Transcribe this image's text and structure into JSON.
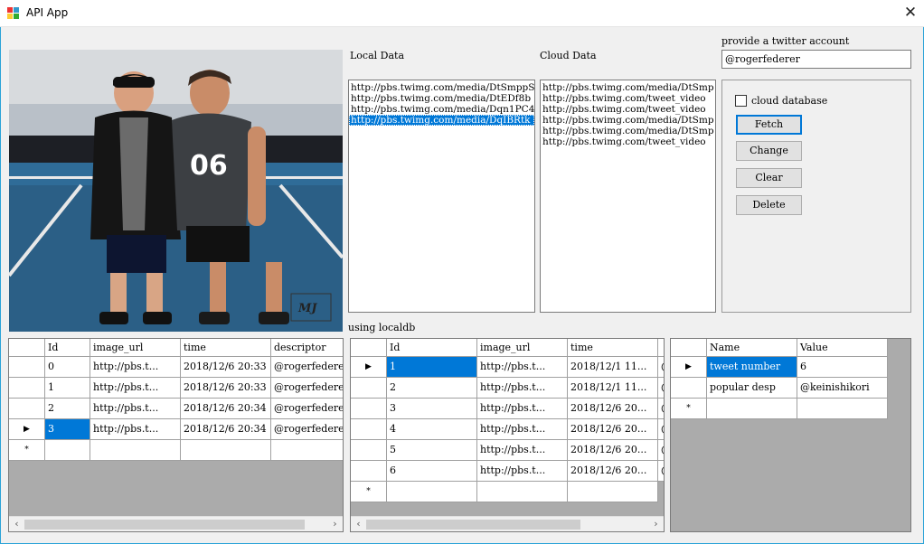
{
  "window": {
    "title": "API App",
    "close_glyph": "✕"
  },
  "labels": {
    "local_data": "Local Data",
    "cloud_data": "Cloud Data",
    "provide_account": "provide a twitter account",
    "using_localdb": "using localdb"
  },
  "account_input": {
    "value": "@rogerfederer"
  },
  "local_list": [
    {
      "text": "http://pbs.twimg.com/media/DtSmppS",
      "selected": false
    },
    {
      "text": "http://pbs.twimg.com/media/DtEDf8b",
      "selected": false
    },
    {
      "text": "http://pbs.twimg.com/media/Dqn1PC4",
      "selected": false
    },
    {
      "text": "http://pbs.twimg.com/media/DqIBRtk",
      "selected": true
    }
  ],
  "cloud_list": [
    "http://pbs.twimg.com/media/DtSmp",
    "http://pbs.twimg.com/tweet_video",
    "http://pbs.twimg.com/tweet_video",
    "http://pbs.twimg.com/media/DtSmp",
    "http://pbs.twimg.com/media/DtSmp",
    "http://pbs.twimg.com/tweet_video"
  ],
  "controls": {
    "cloud_database_label": "cloud database",
    "fetch": "Fetch",
    "change": "Change",
    "clear": "Clear",
    "delete": "Delete"
  },
  "grid_local": {
    "headers": [
      "Id",
      "image_url",
      "time",
      "descriptor"
    ],
    "rows": [
      [
        "0",
        "http://pbs.t...",
        "2018/12/6 20:33",
        "@rogerfederer"
      ],
      [
        "1",
        "http://pbs.t...",
        "2018/12/6 20:33",
        "@rogerfederer"
      ],
      [
        "2",
        "http://pbs.t...",
        "2018/12/6 20:34",
        "@rogerfederer"
      ],
      [
        "3",
        "http://pbs.t...",
        "2018/12/6 20:34",
        "@rogerfederer"
      ]
    ],
    "current_row": 3,
    "new_row_glyph": "*"
  },
  "grid_db": {
    "headers": [
      "Id",
      "image_url",
      "time"
    ],
    "rows": [
      [
        "1",
        "http://pbs.t...",
        "2018/12/1 11...",
        "@"
      ],
      [
        "2",
        "http://pbs.t...",
        "2018/12/1 11...",
        "@"
      ],
      [
        "3",
        "http://pbs.t...",
        "2018/12/6 20...",
        "@"
      ],
      [
        "4",
        "http://pbs.t...",
        "2018/12/6 20...",
        "@"
      ],
      [
        "5",
        "http://pbs.t...",
        "2018/12/6 20...",
        "@"
      ],
      [
        "6",
        "http://pbs.t...",
        "2018/12/6 20...",
        "@"
      ]
    ],
    "current_row": 0,
    "new_row_glyph": "*"
  },
  "grid_stats": {
    "headers": [
      "Name",
      "Value"
    ],
    "rows": [
      [
        "tweet number",
        "6"
      ],
      [
        "popular desp",
        "@keinishikori"
      ]
    ],
    "current_row": 0,
    "new_row_glyph": "*"
  },
  "photo": {
    "jersey_text": "06",
    "watermark": "MJ"
  },
  "icons": {
    "scroll_left": "‹",
    "scroll_right": "›",
    "row_pointer": "▶"
  }
}
